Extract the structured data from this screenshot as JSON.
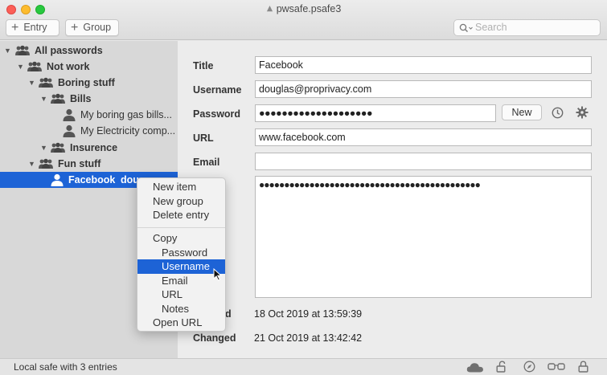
{
  "window": {
    "title": "pwsafe.psafe3"
  },
  "toolbar": {
    "entry_label": "Entry",
    "group_label": "Group",
    "search_placeholder": "Search"
  },
  "tree": {
    "all_passwords": "All passwords",
    "not_work": "Not work",
    "boring_stuff": "Boring stuff",
    "bills": "Bills",
    "gas_bills": "My boring gas bills...",
    "electricity": "My Electricity comp...",
    "insurence": "Insurence",
    "fun_stuff": "Fun stuff",
    "facebook_title": "Facebook",
    "facebook_user": "dou"
  },
  "context_menu": {
    "new_item": "New item",
    "new_group": "New group",
    "delete_entry": "Delete entry",
    "copy": "Copy",
    "password": "Password",
    "username": "Username",
    "email": "Email",
    "url": "URL",
    "notes": "Notes",
    "open_url": "Open URL"
  },
  "detail": {
    "title_label": "Title",
    "title_value": "Facebook",
    "username_label": "Username",
    "username_value": "douglas@proprivacy.com",
    "password_label": "Password",
    "password_value": "●●●●●●●●●●●●●●●●●●●●",
    "new_button": "New",
    "url_label": "URL",
    "url_value": "www.facebook.com",
    "email_label": "Email",
    "email_value": "",
    "notes_value": "●●●●●●●●●●●●●●●●●●●●●●●●●●●●●●●●●●●●●●●●●●●●",
    "created_label_partial": "d",
    "created_value": "18 Oct 2019 at 13:59:39",
    "changed_label": "Changed",
    "changed_value": "21 Oct 2019 at 13:42:42"
  },
  "status": {
    "text": "Local safe with 3 entries"
  },
  "icons": {
    "group": "group-icon",
    "person": "person-icon",
    "history": "clock-icon",
    "settings": "gear-icon",
    "cloud": "cloud-icon",
    "unlock": "unlock-icon",
    "compass": "compass-icon",
    "glasses": "glasses-icon",
    "lock": "lock-icon"
  },
  "colors": {
    "selection": "#1d63d6"
  }
}
